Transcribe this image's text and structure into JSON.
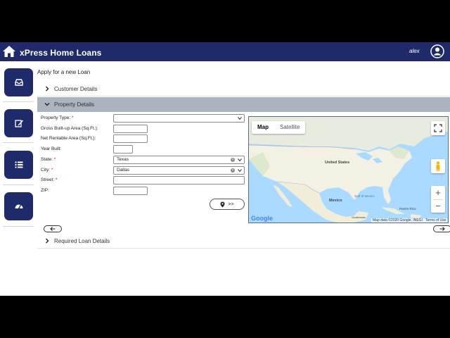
{
  "header": {
    "app_title": "xPress Home Loans",
    "username": "alex",
    "brand_color": "#1f2a6b"
  },
  "sidebar": {
    "items": [
      {
        "icon": "inbox-icon"
      },
      {
        "icon": "edit-icon"
      },
      {
        "icon": "list-icon"
      },
      {
        "icon": "dashboard-icon"
      }
    ]
  },
  "main": {
    "page_title": "Apply for a new Loan",
    "sections": {
      "customer": "Customer Details",
      "property": "Property Details",
      "loan": "Required Loan Details"
    },
    "form": {
      "property_type_label": "Property Type:",
      "gross_area_label": "Gross Built-up Area (Sq.Ft.):",
      "net_area_label": "Net Rentable Area (Sq.Ft.):",
      "year_built_label": "Year Built:",
      "state_label": "State:",
      "state_value": "Texas",
      "city_label": "City:",
      "city_value": "Dallas",
      "street_label": "Street:",
      "zip_label": "ZIP:",
      "required_mark": "*",
      "locate_button_label": ">>"
    },
    "map": {
      "type_map": "Map",
      "type_satellite": "Satellite",
      "labels": {
        "united_states": "United States",
        "mexico": "Mexico",
        "gulf": "Gulf of Mexico",
        "puerto_rico": "Puerto Rico",
        "guatemala": "Guatemala"
      },
      "attribution": "Map data ©2020 Google, INEGI",
      "terms": "Terms of Use",
      "google_logo": "Google",
      "zoom_in": "+",
      "zoom_out": "−"
    }
  }
}
